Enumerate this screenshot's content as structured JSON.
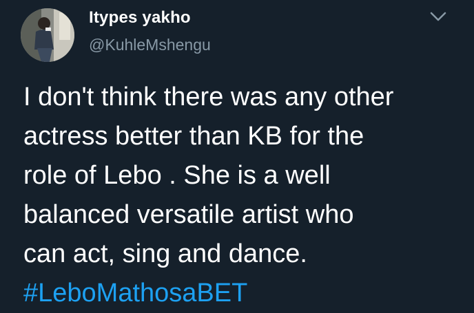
{
  "tweet": {
    "author": {
      "display_name": "Itypes yakho",
      "handle": "@KuhleMshengu"
    },
    "text_lines": [
      "I don't think there was any other",
      "actress better than KB for the",
      "role of Lebo . She is a well",
      "balanced versatile artist who",
      "can act, sing and dance."
    ],
    "hashtag": "#LeboMathosaBET",
    "menu_icon": "chevron-down-icon",
    "colors": {
      "background": "#15202b",
      "text": "#ffffff",
      "secondary_text": "#8899a6",
      "link": "#1da1f2"
    }
  }
}
